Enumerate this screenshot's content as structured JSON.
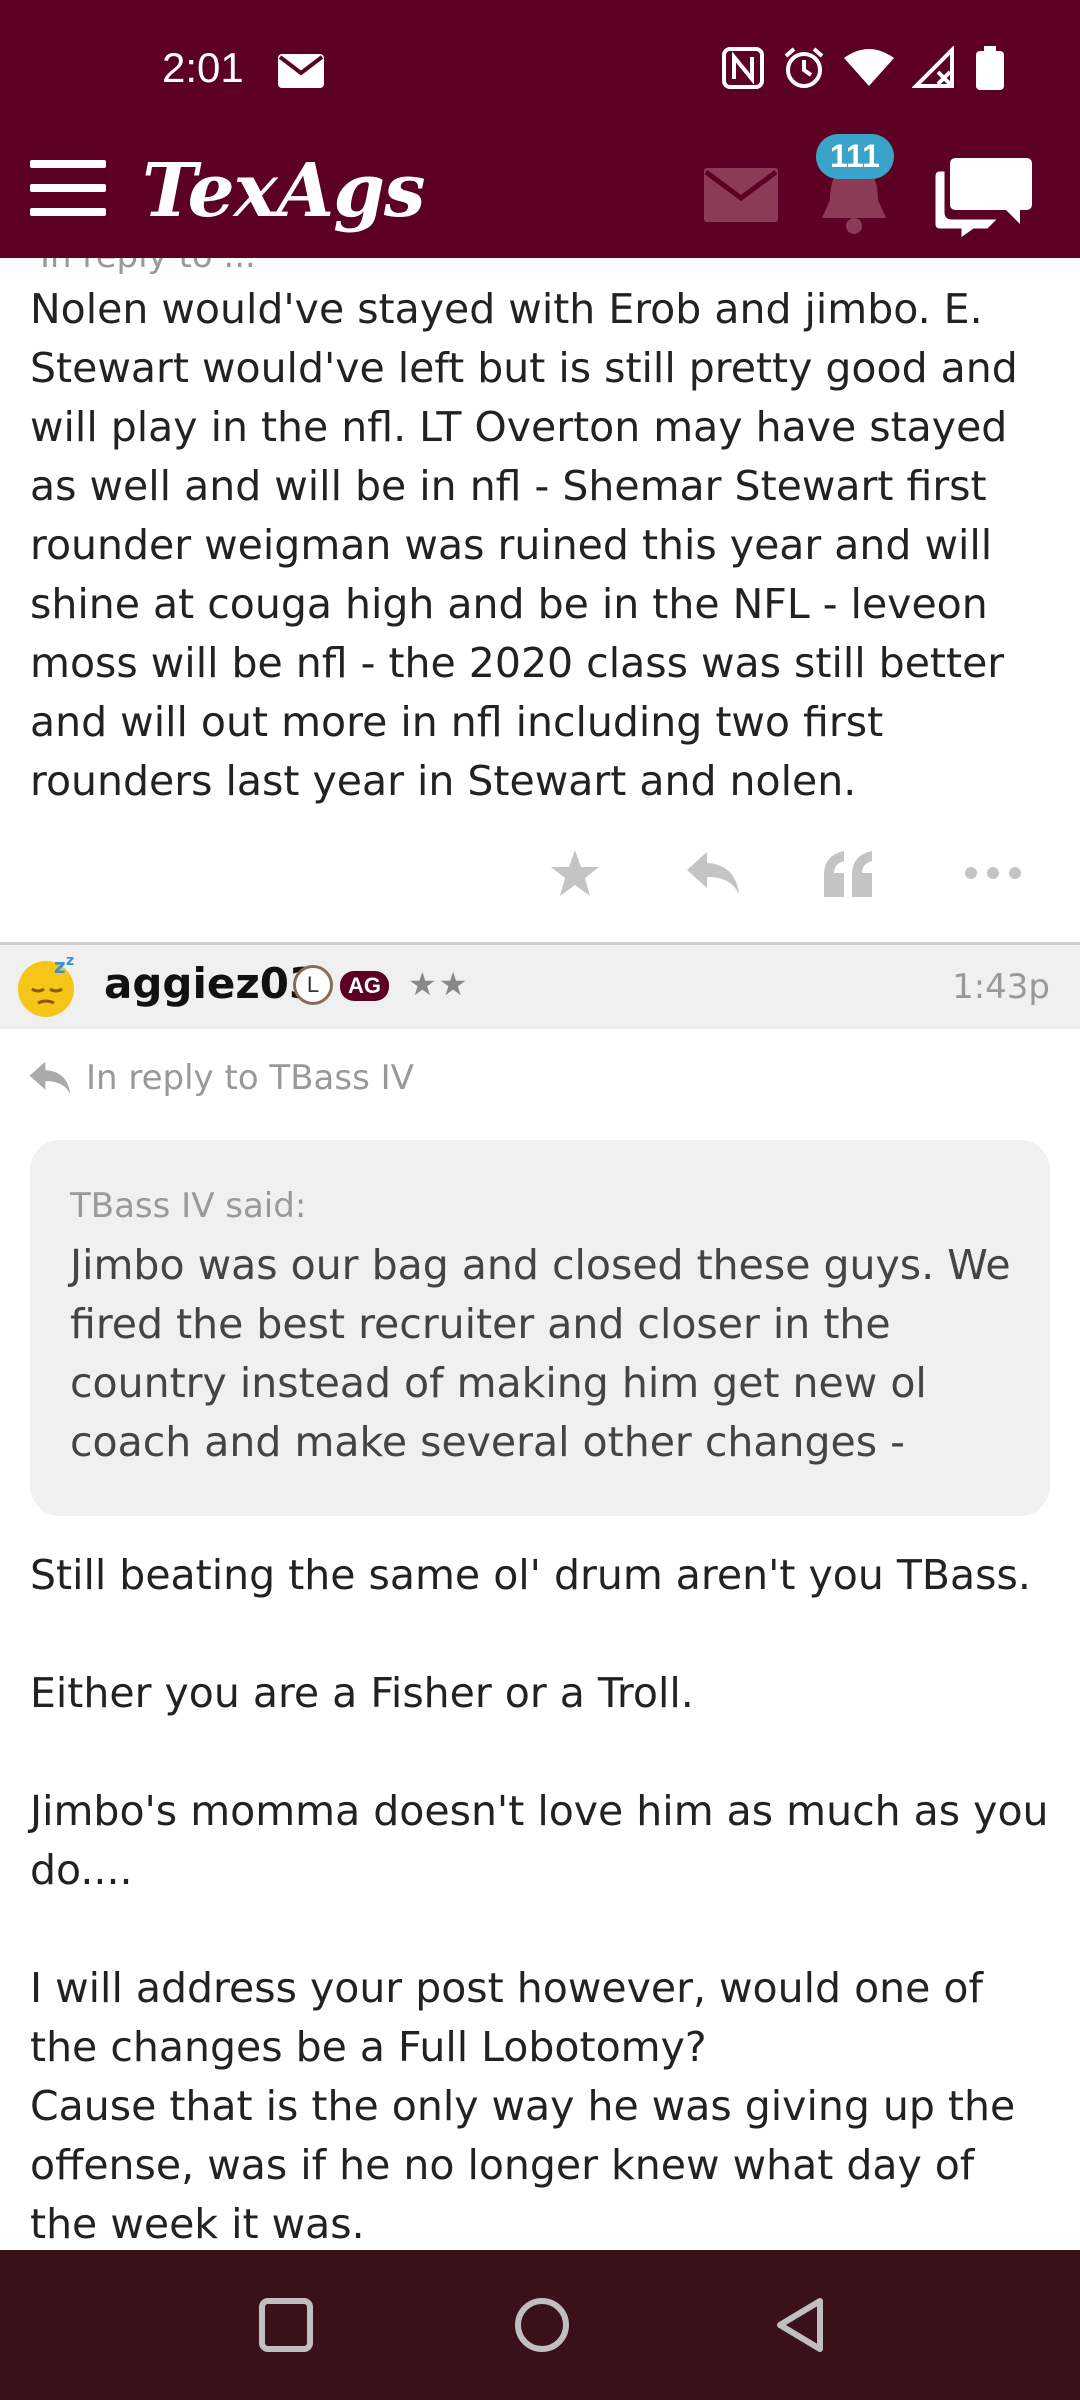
{
  "status_bar": {
    "time": "2:01"
  },
  "header": {
    "logo": "TexAgs",
    "notification_count": "111"
  },
  "previous_post": {
    "reply_cut": "In reply to ...",
    "text": "Nolen would've stayed with Erob and jimbo. E. Stewart would've left but is still pretty good and will play in the nfl. LT Overton may have stayed as well and will be in nfl - Shemar Stewart first rounder weigman was ruined this year and will shine at couga high and be in the NFL - leveon moss will be nfl - the 2020 class was still better and will out more in nfl including two first rounders last year in Stewart and nolen."
  },
  "post": {
    "username": "aggiez03",
    "badge_l": "L",
    "badge_ag": "AG",
    "stars": "★★",
    "time": "1:43p",
    "reply_to": "In reply to TBass IV",
    "quote_author": "TBass IV said:",
    "quote_text": "Jimbo was our bag and closed these guys. We fired the best recruiter and closer in the country instead of making him get new ol coach and make several other changes -",
    "body": "Still beating the same ol' drum aren't you TBass.\n\nEither you are a Fisher or a Troll.\n\nJimbo's momma doesn't love him as much as you do....\n\nI will address your post however, would one of the changes be a Full Lobotomy?\nCause that is the only way he was giving up the offense, was if he no longer knew what day of the week it was."
  },
  "colors": {
    "brand": "#5c0024",
    "badge": "#3aa3c8",
    "nav": "#3a1019"
  }
}
